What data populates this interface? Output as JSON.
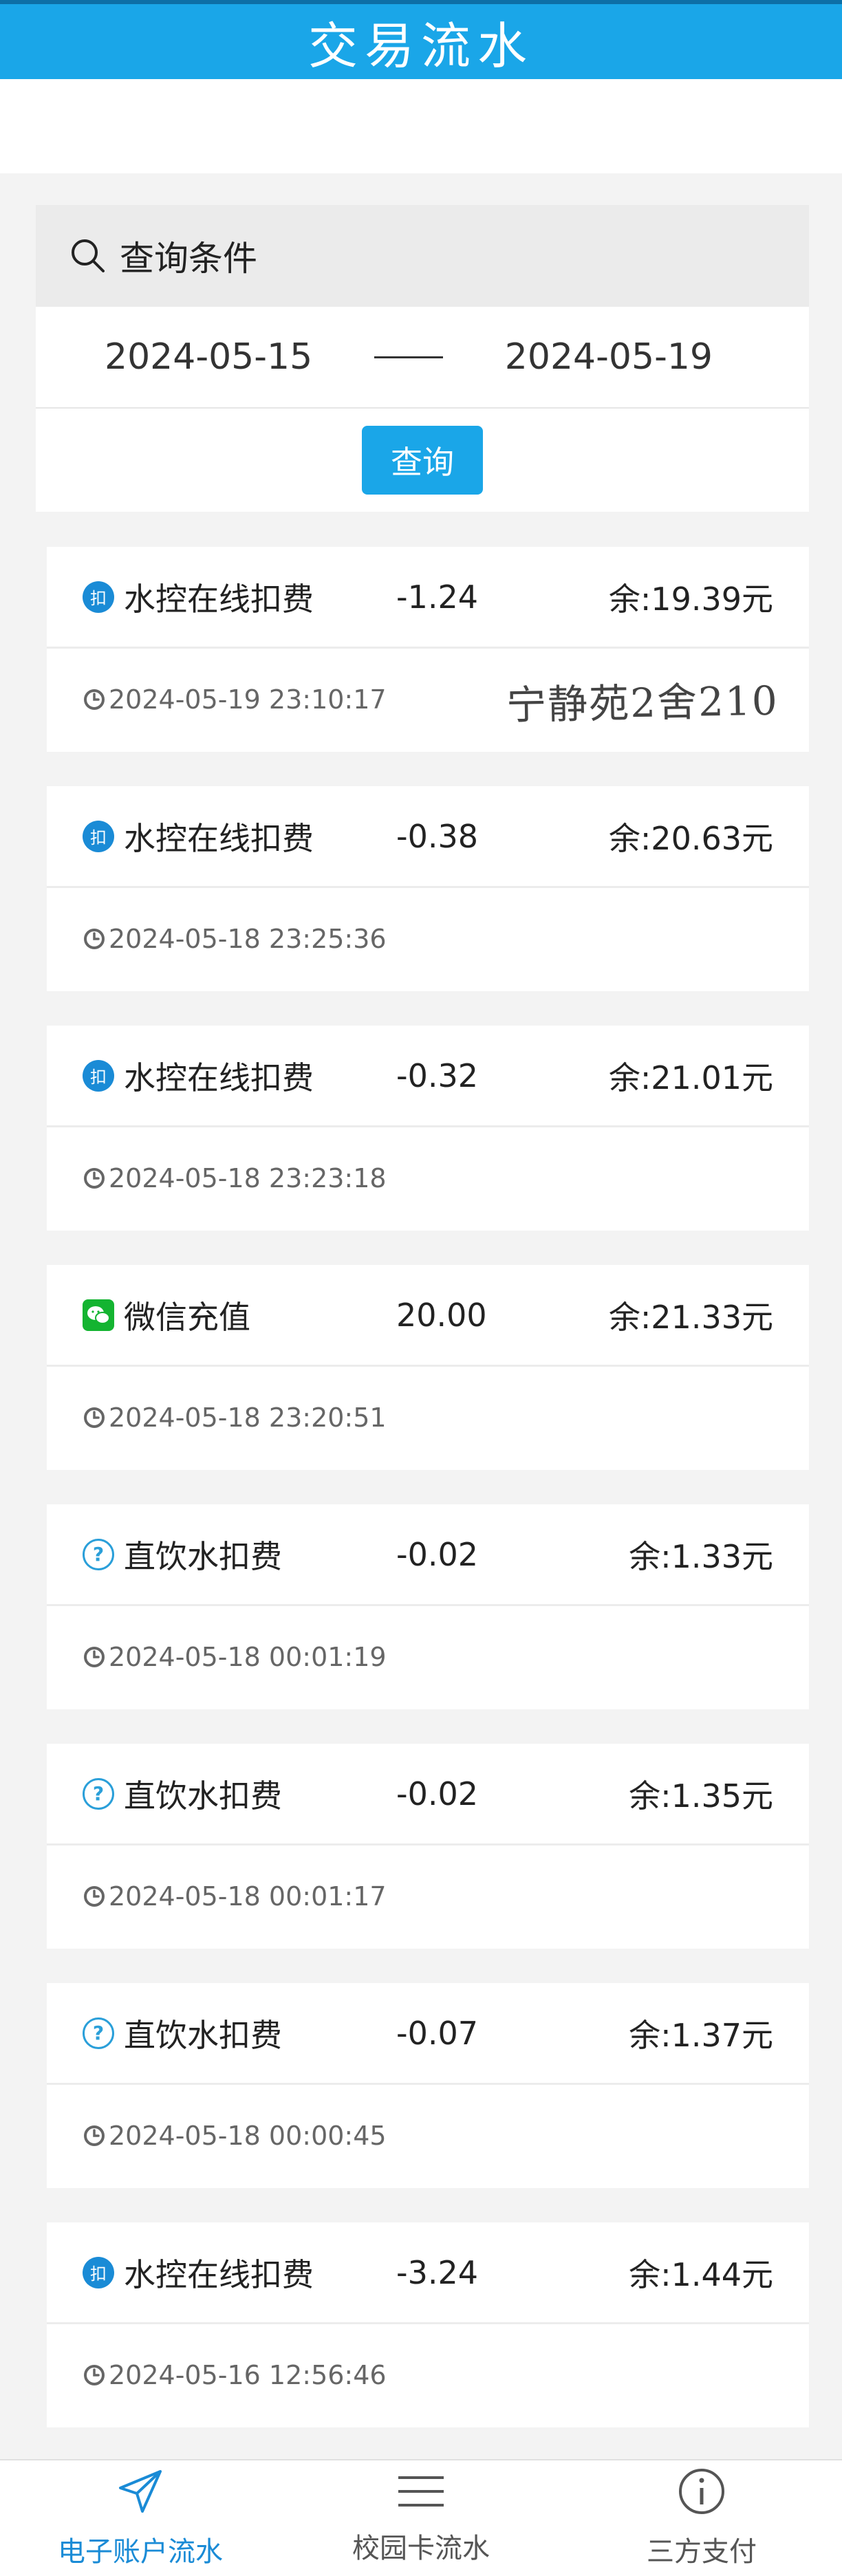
{
  "header": {
    "title": "交易流水"
  },
  "query": {
    "title": "查询条件",
    "start_date": "2024-05-15",
    "end_date": "2024-05-19",
    "button": "查询"
  },
  "transactions": [
    {
      "icon": "deduct-icon",
      "icon_text": "扣",
      "name": "水控在线扣费",
      "amount": "-1.24",
      "balance": "余:19.39元",
      "time": "2024-05-19 23:10:17",
      "note": "宁静苑2舍210"
    },
    {
      "icon": "deduct-icon",
      "icon_text": "扣",
      "name": "水控在线扣费",
      "amount": "-0.38",
      "balance": "余:20.63元",
      "time": "2024-05-18 23:25:36",
      "note": ""
    },
    {
      "icon": "deduct-icon",
      "icon_text": "扣",
      "name": "水控在线扣费",
      "amount": "-0.32",
      "balance": "余:21.01元",
      "time": "2024-05-18 23:23:18",
      "note": ""
    },
    {
      "icon": "wechat-icon",
      "icon_text": "",
      "name": "微信充值",
      "amount": "20.00",
      "balance": "余:21.33元",
      "time": "2024-05-18 23:20:51",
      "note": ""
    },
    {
      "icon": "help-icon",
      "icon_text": "?",
      "name": "直饮水扣费",
      "amount": "-0.02",
      "balance": "余:1.33元",
      "time": "2024-05-18 00:01:19",
      "note": ""
    },
    {
      "icon": "help-icon",
      "icon_text": "?",
      "name": "直饮水扣费",
      "amount": "-0.02",
      "balance": "余:1.35元",
      "time": "2024-05-18 00:01:17",
      "note": ""
    },
    {
      "icon": "help-icon",
      "icon_text": "?",
      "name": "直饮水扣费",
      "amount": "-0.07",
      "balance": "余:1.37元",
      "time": "2024-05-18 00:00:45",
      "note": ""
    },
    {
      "icon": "deduct-icon",
      "icon_text": "扣",
      "name": "水控在线扣费",
      "amount": "-3.24",
      "balance": "余:1.44元",
      "time": "2024-05-16 12:56:46",
      "note": ""
    }
  ],
  "nav": [
    {
      "label": "电子账户流水",
      "icon": "send-icon",
      "active": true
    },
    {
      "label": "校园卡流水",
      "icon": "menu-icon",
      "active": false
    },
    {
      "label": "三方支付",
      "icon": "info-icon",
      "active": false
    }
  ],
  "colors": {
    "accent": "#1aa6e8",
    "wechat": "#14b431"
  }
}
